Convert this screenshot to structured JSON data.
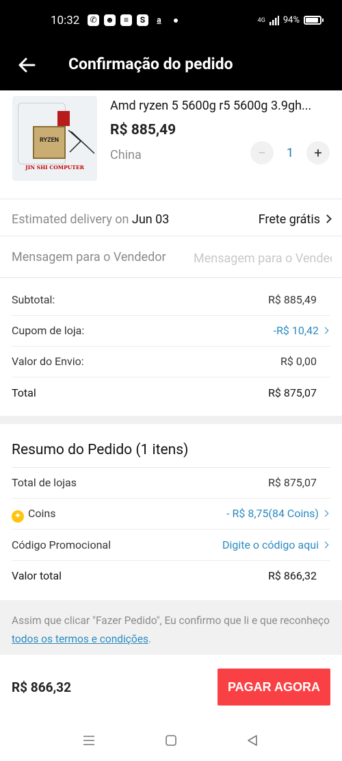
{
  "status_bar": {
    "time": "10:32",
    "notification_icons": [
      "whatsapp-icon",
      "mask-icon",
      "chat-icon",
      "s-icon",
      "a-icon",
      "dot-icon"
    ],
    "network": "4G",
    "battery": "94%"
  },
  "header": {
    "title": "Confirmação do pedido"
  },
  "product": {
    "title": "Amd ryzen 5 5600g r5 5600g 3.9gh...",
    "price": "R$ 885,49",
    "origin": "China",
    "quantity": "1",
    "image_brand": "RYZEN",
    "image_shop": "JIN SHI COMPUTER"
  },
  "delivery": {
    "label": "Estimated delivery on ",
    "date": "Jun 03",
    "shipping": "Frete grátis"
  },
  "message": {
    "label": "Mensagem para o Vendedor",
    "placeholder": "Mensagem para o Vendedor"
  },
  "summary": {
    "subtotal_label": "Subtotal:",
    "subtotal_value": "R$ 885,49",
    "coupon_label": "Cupom de loja:",
    "coupon_value": "-R$ 10,42",
    "shipping_label": "Valor do Envio:",
    "shipping_value": "R$ 0,00",
    "total_label": "Total",
    "total_value": "R$ 875,07"
  },
  "order_summary": {
    "title": "Resumo do Pedido (1 itens)",
    "stores_total_label": "Total de lojas",
    "stores_total_value": "R$ 875,07",
    "coins_label": "Coins",
    "coins_value": "- R$ 8,75(84 Coins)",
    "promo_label": "Código Promocional",
    "promo_value": "Digite o código aqui",
    "grand_total_label": "Valor total",
    "grand_total_value": "R$ 866,32"
  },
  "notice": {
    "text": "Assim que clicar \"Fazer Pedido\", Eu confirmo que li e que reconheço ",
    "link": "todos os termos e condições",
    "suffix": "."
  },
  "footer": {
    "total": "R$ 866,32",
    "pay_button": "PAGAR AGORA"
  },
  "colors": {
    "accent_blue": "#2a8bc0",
    "pay_red": "#f94044",
    "header_bg": "#000000"
  }
}
